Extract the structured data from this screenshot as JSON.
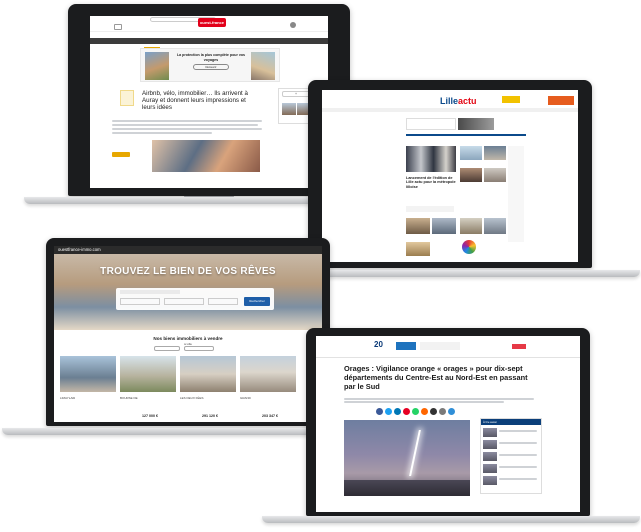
{
  "laptop1": {
    "nav_items": [
      "Actualité",
      "Bretagne",
      "Pays de la Loire",
      "Normandie",
      "Sport",
      "Économie",
      "Loisirs",
      "Culture",
      "Météo"
    ],
    "active_nav": "Bretagne",
    "logo": "ouest-france",
    "ad_title": "La protection la plus complète pour vos voyages",
    "ad_button": "Découvrir",
    "headline": "Airbnb, vélo, immobilier… Ils arrivent à Auray et donnent leurs impressions et leurs idées",
    "abonne": "Abonnés"
  },
  "laptop2": {
    "logo_main": "Lille",
    "logo_accent": "actu",
    "headline": "Lancement de l'édition de Lille actu pour la métropole lilloise"
  },
  "laptop3": {
    "site": "ouestfrance-immo.com",
    "hero_title": "TROUVEZ LE BIEN DE VOS RÊVES",
    "search_button": "Rechercher",
    "section_title": "Nos biens immobiliers à vendre",
    "section_subtitle": "à Lille",
    "cards": [
      {
        "label": "LIMAYLAIR",
        "price": ""
      },
      {
        "label": "BOURSE DE",
        "price": "127 000 €"
      },
      {
        "label": "LES DEUX FÉES",
        "price": "291 120 €"
      },
      {
        "label": "GRAND",
        "price": "203 347 €"
      }
    ]
  },
  "laptop4": {
    "logo": "20",
    "title": "Orages : Vigilance orange « orages » pour dix-sept départements du Centre-Est au Nord-Est en passant par le Sud",
    "sidebar_head": "À lire aussi",
    "social_colors": [
      "#3b5998",
      "#1da1f2",
      "#0077b5",
      "#e60023",
      "#25d366",
      "#ff6600",
      "#333333",
      "#7a7a7a",
      "#2f8fd8"
    ]
  }
}
